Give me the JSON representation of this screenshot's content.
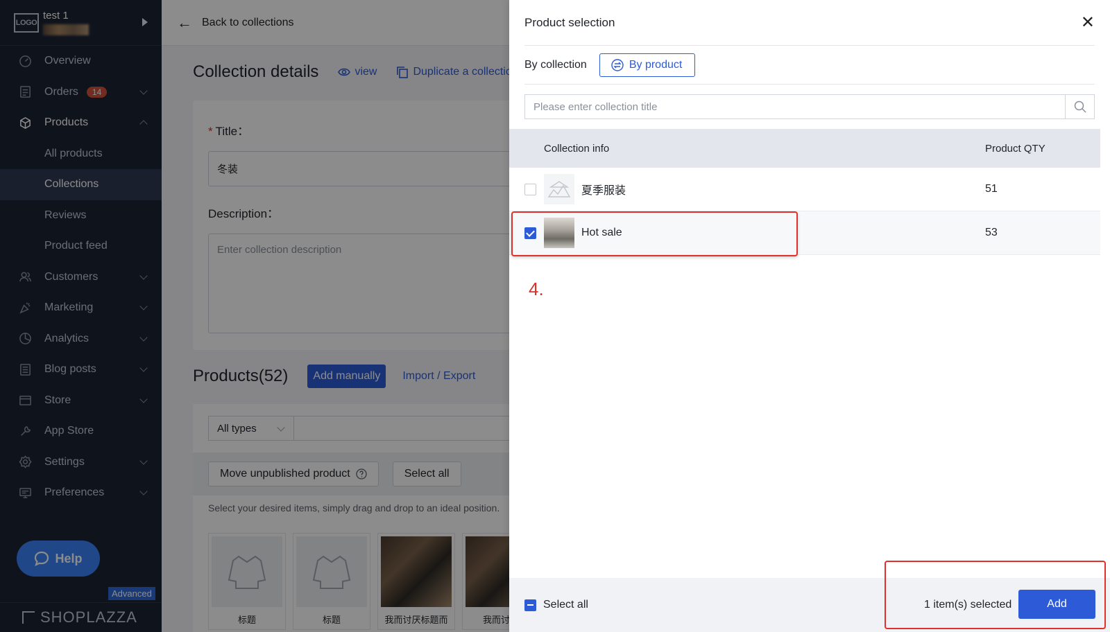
{
  "sidebar": {
    "store_name": "test 1",
    "logo_text": "LOGO",
    "items": [
      {
        "label": "Overview",
        "icon": "overview-icon"
      },
      {
        "label": "Orders",
        "icon": "orders-icon",
        "badge": "14"
      },
      {
        "label": "Products",
        "icon": "products-icon"
      },
      {
        "label": "Customers",
        "icon": "customers-icon"
      },
      {
        "label": "Marketing",
        "icon": "marketing-icon"
      },
      {
        "label": "Analytics",
        "icon": "analytics-icon"
      },
      {
        "label": "Blog posts",
        "icon": "blog-icon"
      },
      {
        "label": "Store",
        "icon": "store-icon"
      },
      {
        "label": "App Store",
        "icon": "app-store-icon"
      },
      {
        "label": "Settings",
        "icon": "settings-icon"
      },
      {
        "label": "Preferences",
        "icon": "preferences-icon"
      }
    ],
    "product_subitems": [
      "All products",
      "Collections",
      "Reviews",
      "Product feed"
    ],
    "help_label": "Help",
    "advanced_tag": "Advanced",
    "brand": "SHOPLAZZA"
  },
  "main": {
    "back_label": "Back to collections",
    "page_title": "Collection details",
    "view_label": "view",
    "duplicate_label": "Duplicate a collectio",
    "title_label": "Title：",
    "title_value": "冬装",
    "description_label": "Description：",
    "description_placeholder": "Enter collection description",
    "products_title": "Products(52)",
    "add_manually_label": "Add manually",
    "import_export_label": "Import / Export",
    "type_filter": "All types",
    "move_unpublished_label": "Move unpublished product",
    "select_all_label": "Select all",
    "hint_text": "Select your desired items, simply drag and drop to an ideal position.",
    "thumbs": [
      {
        "caption": "标题"
      },
      {
        "caption": "标题"
      },
      {
        "caption": "我而讨厌标题而"
      },
      {
        "caption": "我而讨厌"
      }
    ]
  },
  "drawer": {
    "title": "Product selection",
    "tab_by_collection": "By collection",
    "tab_by_product": "By product",
    "search_placeholder": "Please enter collection title",
    "col_info": "Collection info",
    "col_qty": "Product QTY",
    "rows": [
      {
        "name": "夏季服装",
        "qty": "51",
        "checked": false
      },
      {
        "name": "Hot sale",
        "qty": "53",
        "checked": true
      }
    ],
    "annotation_number": "4.",
    "footer_select_all": "Select all",
    "footer_count": "1 item(s) selected",
    "add_label": "Add"
  },
  "colors": {
    "accent": "#2d5bd7",
    "annotation": "#e0302a",
    "sidebar_bg": "#1c2434",
    "badge": "#d4513b"
  }
}
